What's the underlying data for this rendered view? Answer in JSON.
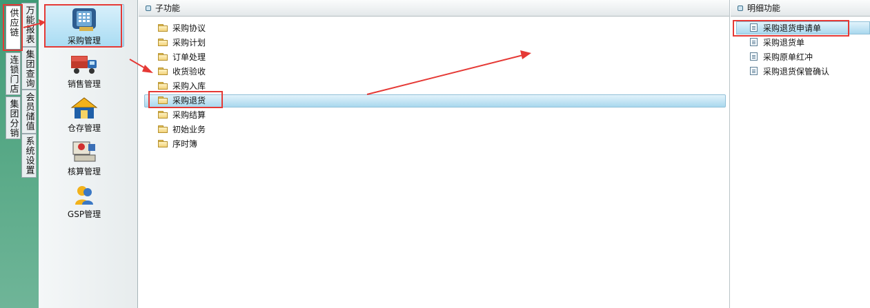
{
  "vertical_tabs": {
    "left_col": [
      "供应链",
      "连锁门店",
      "集团分销"
    ],
    "right_col": [
      "万能报表",
      "集团查询",
      "会员储值",
      "系统设置"
    ]
  },
  "modules": [
    {
      "label": "采购管理",
      "icon": "purchase-phone-icon",
      "selected": true
    },
    {
      "label": "销售管理",
      "icon": "delivery-truck-icon"
    },
    {
      "label": "仓存管理",
      "icon": "warehouse-house-icon"
    },
    {
      "label": "核算管理",
      "icon": "accounting-computer-icon"
    },
    {
      "label": "GSP管理",
      "icon": "gsp-user-icon"
    }
  ],
  "sub_panel": {
    "title": "子功能",
    "items": [
      "采购协议",
      "采购计划",
      "订单处理",
      "收货验收",
      "采购入库",
      "采购退货",
      "采购结算",
      "初始业务",
      "序时簿"
    ],
    "selected": "采购退货"
  },
  "detail_panel": {
    "title": "明细功能",
    "items": [
      "采购退货申请单",
      "采购退货单",
      "采购原单红冲",
      "采购退货保管确认"
    ],
    "selected": "采购退货申请单"
  },
  "colors": {
    "annotation_red": "#e53935",
    "left_strip_green": "#4fa37f",
    "selection_blue": "#a9d8ee"
  }
}
